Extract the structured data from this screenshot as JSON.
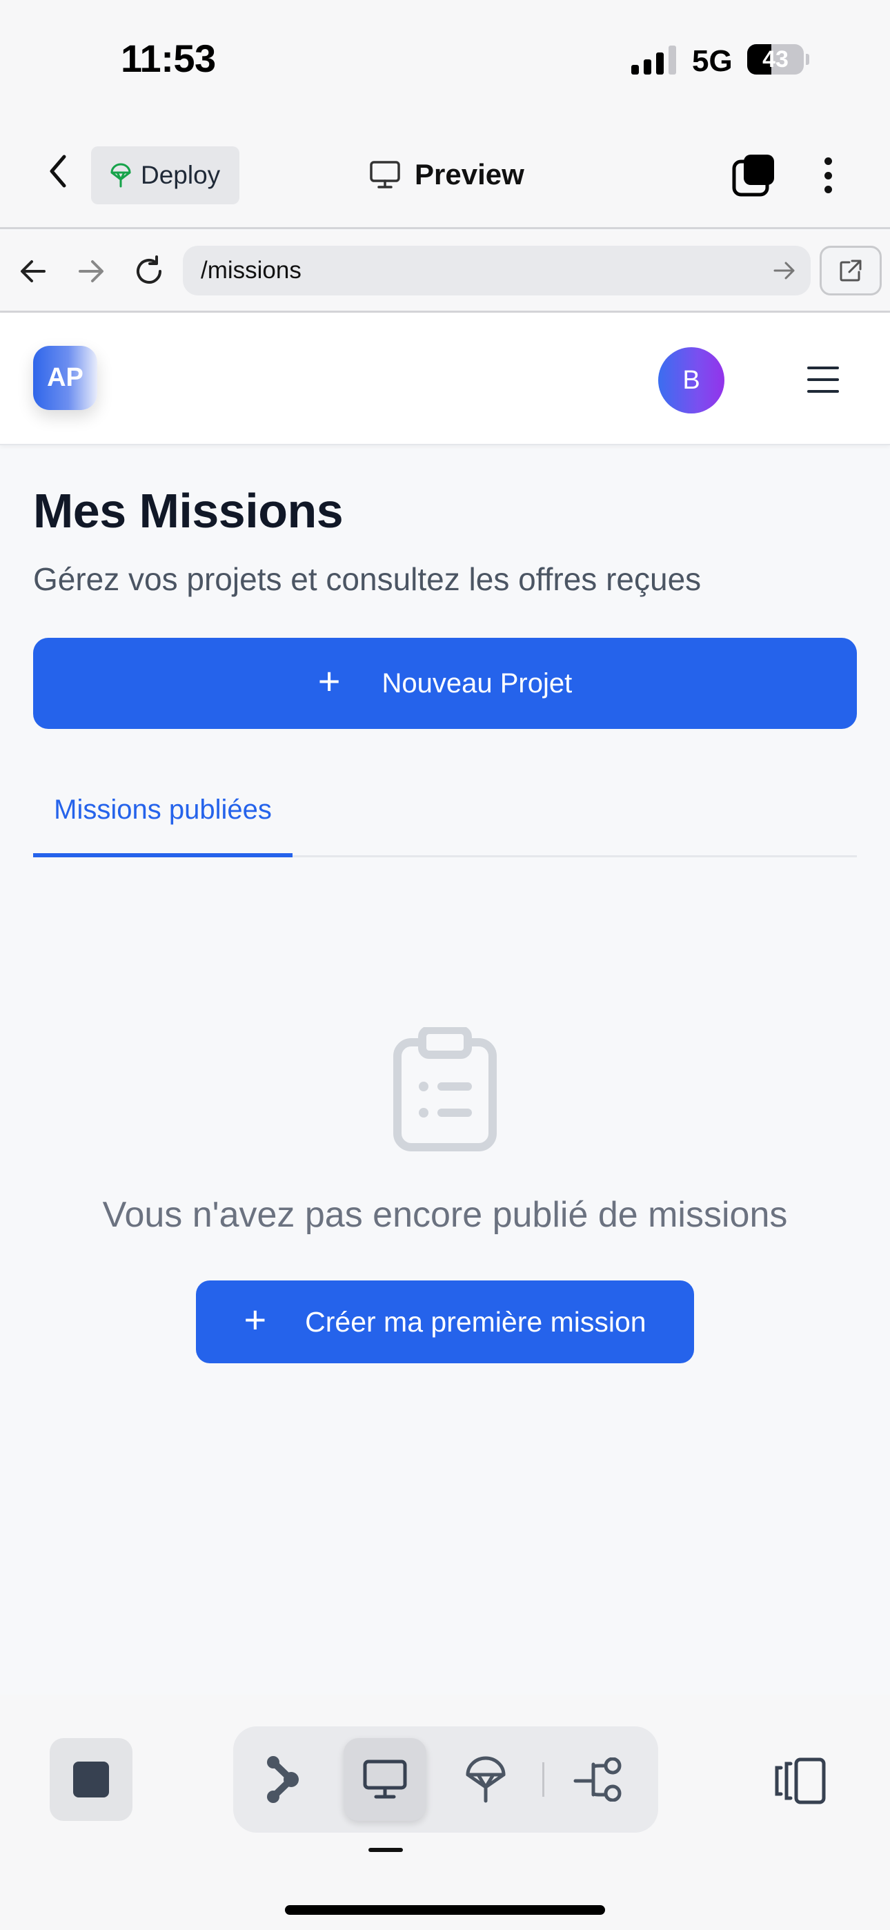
{
  "status_bar": {
    "time": "11:53",
    "network": "5G",
    "battery_level": "43",
    "battery_fraction": 0.43
  },
  "app_header": {
    "back_icon": "chevron-left-icon",
    "deploy_label": "Deploy",
    "deploy_icon": "deploy-parachute-icon",
    "preview_label": "Preview",
    "preview_icon": "monitor-icon",
    "tabs_icon": "tabs-icon",
    "more_icon": "more-vertical-icon"
  },
  "browser_bar": {
    "url": "/missions",
    "back_icon": "arrow-left-icon",
    "forward_icon": "arrow-right-icon",
    "reload_icon": "reload-icon",
    "go_icon": "arrow-right-icon",
    "external_icon": "external-link-icon"
  },
  "site_nav": {
    "logo_text": "AP",
    "avatar_initial": "B",
    "menu_icon": "hamburger-icon"
  },
  "main": {
    "title": "Mes Missions",
    "subtitle": "Gérez vos projets et consultez les offres reçues",
    "new_project_button": "Nouveau Projet",
    "plus_symbol": "+",
    "tabs": [
      {
        "label": "Missions publiées",
        "active": true
      }
    ],
    "empty_state": {
      "icon": "clipboard-icon",
      "message": "Vous n'avez pas encore publié de missions",
      "create_button": "Créer ma première mission"
    }
  },
  "bottom_toolbar": {
    "stop_icon": "stop-icon",
    "tools": [
      {
        "icon": "agent-icon",
        "active": false
      },
      {
        "icon": "monitor-icon",
        "active": true
      },
      {
        "icon": "deploy-parachute-icon",
        "active": false
      },
      {
        "icon": "git-branch-icon",
        "active": false
      }
    ],
    "device_icon": "device-preview-icon"
  },
  "colors": {
    "accent": "#2563eb",
    "page_background": "#f7f8fa",
    "muted_text": "#6b7280"
  }
}
